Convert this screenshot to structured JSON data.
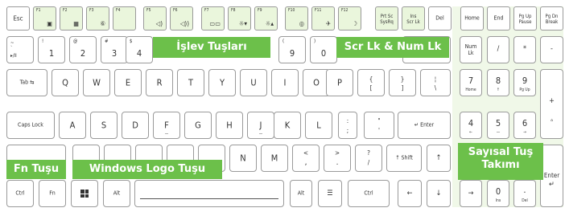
{
  "fkeys": [
    {
      "num": "",
      "main": "Esc"
    },
    {
      "num": "F1",
      "main": "▣"
    },
    {
      "num": "F2",
      "main": "▦"
    },
    {
      "num": "F3",
      "main": "⑥"
    },
    {
      "num": "F4",
      "main": ""
    },
    {
      "num": "F5",
      "main": "◁)"
    },
    {
      "num": "F6",
      "main": "◁))"
    },
    {
      "num": "F7",
      "main": "▭▭"
    },
    {
      "num": "F8",
      "main": "☼▾"
    },
    {
      "num": "F9",
      "main": "☼▴"
    },
    {
      "num": "F10",
      "main": "◎"
    },
    {
      "num": "F11",
      "main": "✈"
    },
    {
      "num": "F12",
      "main": "☽"
    }
  ],
  "top_right": {
    "prtsc": [
      "Prt Sc",
      "SysRq"
    ],
    "ins": [
      "Ins",
      "Scr Lk"
    ],
    "del": "Del",
    "home": "Home",
    "end": "End",
    "pgup": [
      "Pg Up",
      "Pause"
    ],
    "pgdn": [
      "Pg Dn",
      "Break"
    ]
  },
  "row1": {
    "tilde": [
      "~",
      "`",
      "▸/II"
    ],
    "k1": [
      "!",
      "1"
    ],
    "k2": [
      "@",
      "2"
    ],
    "k3": [
      "#",
      "3"
    ],
    "k4": [
      "$",
      "4"
    ],
    "k9": [
      "(",
      "9"
    ],
    "k0": [
      ")",
      "0"
    ],
    "numlk": [
      "Num",
      "Lk"
    ],
    "slash": "/",
    "star": "*",
    "minus": "-"
  },
  "row2": {
    "tab": "Tab ⇆",
    "letters": [
      "Q",
      "W",
      "E",
      "R",
      "T",
      "Y",
      "U",
      "I",
      "O",
      "P"
    ],
    "lbrace": [
      "{",
      "["
    ],
    "rbrace": [
      "}",
      "]"
    ],
    "pipe": [
      "¦",
      "\\"
    ],
    "n7": [
      "7",
      "Home"
    ],
    "n8": [
      "8",
      "↑"
    ],
    "n9": [
      "9",
      "Pg Up"
    ],
    "nplus": "+"
  },
  "row3": {
    "caps": "Caps Lock",
    "letters": [
      "A",
      "S",
      "D",
      "F",
      "G",
      "H",
      "J",
      "K",
      "L"
    ],
    "colon": [
      ":",
      ";"
    ],
    "quote": [
      "\"",
      "'"
    ],
    "enter": "↵ Enter",
    "n4": [
      "4",
      "←"
    ],
    "n5": "5",
    "n6": [
      "6",
      "→"
    ]
  },
  "row4": {
    "letters": [
      "N",
      "M"
    ],
    "lt": [
      "<",
      ","
    ],
    "gt": [
      ">",
      "."
    ],
    "q": [
      "?",
      "/"
    ],
    "shift": "↑ Shift",
    "up": "↑"
  },
  "row5": {
    "ctrl": "Ctrl",
    "fn": "Fn",
    "alt": "Alt",
    "altgr": "Alt",
    "menu": "☰",
    "rctrl": "Ctrl",
    "left": "←",
    "down": "↓",
    "right": "→",
    "n0": [
      "0",
      "Ins"
    ],
    "ndot": [
      ".",
      "Del"
    ],
    "nenter": [
      "Enter",
      "↵"
    ]
  },
  "callouts": {
    "islev": "İşlev Tuşları",
    "scr": "Scr Lk & Num Lk",
    "fn": "Fn Tuşu",
    "win": "Windows Logo Tuşu",
    "numpad": "Sayısal Tuş Takımı"
  }
}
